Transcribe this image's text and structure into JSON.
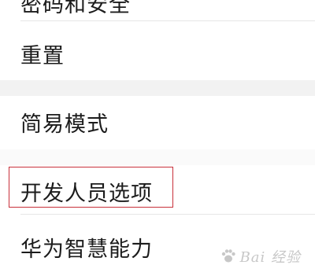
{
  "settings_list": {
    "items": [
      {
        "label": "密码和安全"
      },
      {
        "label": "重置"
      },
      {
        "label": "简易模式"
      },
      {
        "label": "开发人员选项"
      },
      {
        "label": "华为智慧能力"
      }
    ]
  },
  "watermark": {
    "text": "Bai 经验"
  },
  "colors": {
    "highlight": "#c8303a",
    "text": "#1c1c1c",
    "divider": "#e6e6e6"
  }
}
